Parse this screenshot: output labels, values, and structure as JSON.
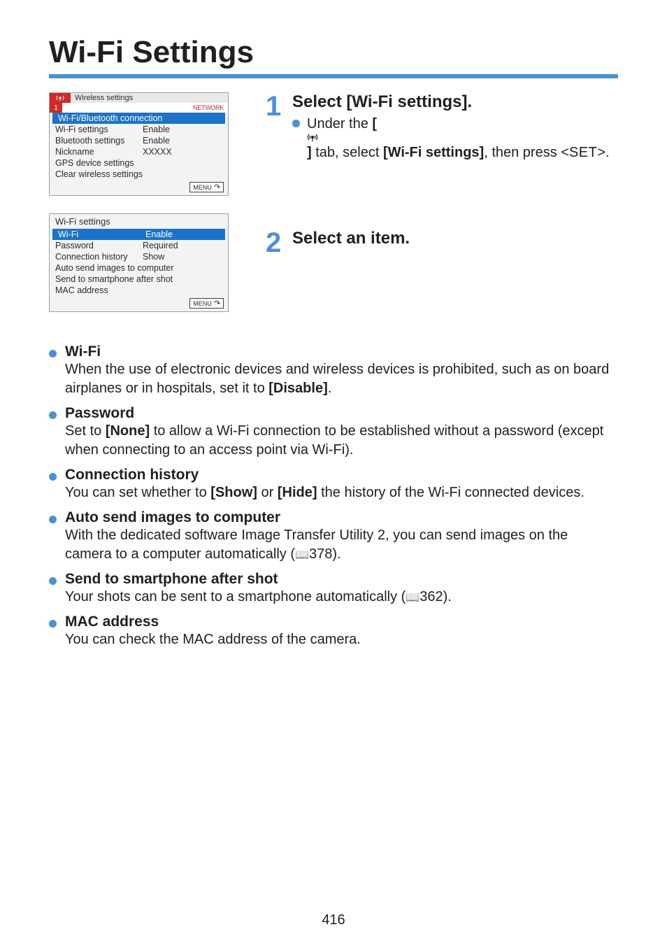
{
  "page_title": "Wi-Fi Settings",
  "page_number": "416",
  "icons": {
    "wifi_tab_glyph": "((•))",
    "menu_label": "MENU",
    "set_label": "SET",
    "book": "📖"
  },
  "lcd1": {
    "tab_name": "Wireless settings",
    "header_num": "1",
    "header_right": "NETWORK",
    "rows": [
      {
        "label": "Wi-Fi/Bluetooth connection",
        "value": "",
        "highlight": true,
        "single": true
      },
      {
        "label": "Wi-Fi settings",
        "value": "Enable"
      },
      {
        "label": "Bluetooth settings",
        "value": "Enable"
      },
      {
        "label": "Nickname",
        "value": "XXXXX"
      },
      {
        "label": "GPS device settings",
        "value": "",
        "single": true
      },
      {
        "label": "Clear wireless settings",
        "value": "",
        "single": true
      }
    ]
  },
  "lcd2": {
    "title": "Wi-Fi settings",
    "rows": [
      {
        "label": "Wi-Fi",
        "value": "Enable",
        "highlight": true
      },
      {
        "label": "Password",
        "value": "Required"
      },
      {
        "label": "Connection history",
        "value": "Show"
      },
      {
        "label": "Auto send images to computer",
        "value": "",
        "single": true
      },
      {
        "label": "Send to smartphone after shot",
        "value": "",
        "single": true
      },
      {
        "label": "MAC address",
        "value": "",
        "single": true
      }
    ]
  },
  "steps": [
    {
      "num": "1",
      "title": "Select [Wi-Fi settings].",
      "body_parts": {
        "pre": "Under the ",
        "lbrace": "[",
        "rbrace": "]",
        "mid": " tab, select ",
        "bold1": "[Wi-Fi settings]",
        "post1": ", then press <",
        "post2": ">."
      }
    },
    {
      "num": "2",
      "title": "Select an item.",
      "body_parts": null
    }
  ],
  "features": [
    {
      "title": "Wi-Fi",
      "body_pre": "When the use of electronic devices and wireless devices is prohibited, such as on board airplanes or in hospitals, set it to ",
      "bold": "[Disable]",
      "body_post": "."
    },
    {
      "title": "Password",
      "body_pre": "Set to ",
      "bold": "[None]",
      "body_post": " to allow a Wi-Fi connection to be established without a password (except when connecting to an access point via Wi-Fi)."
    },
    {
      "title": "Connection history",
      "body_pre": "You can set whether to ",
      "bold": "[Show]",
      "mid": " or ",
      "bold2": "[Hide]",
      "body_post": " the history of the Wi-Fi connected devices."
    },
    {
      "title": "Auto send images to computer",
      "body_pre": "With the dedicated software Image Transfer Utility 2, you can send images on the camera to a computer automatically (",
      "ref": "378",
      "body_post": ")."
    },
    {
      "title": "Send to smartphone after shot",
      "body_pre": "Your shots can be sent to a smartphone automatically (",
      "ref": "362",
      "body_post": ")."
    },
    {
      "title": "MAC address",
      "body_pre": "You can check the MAC address of the camera.",
      "body_post": ""
    }
  ]
}
